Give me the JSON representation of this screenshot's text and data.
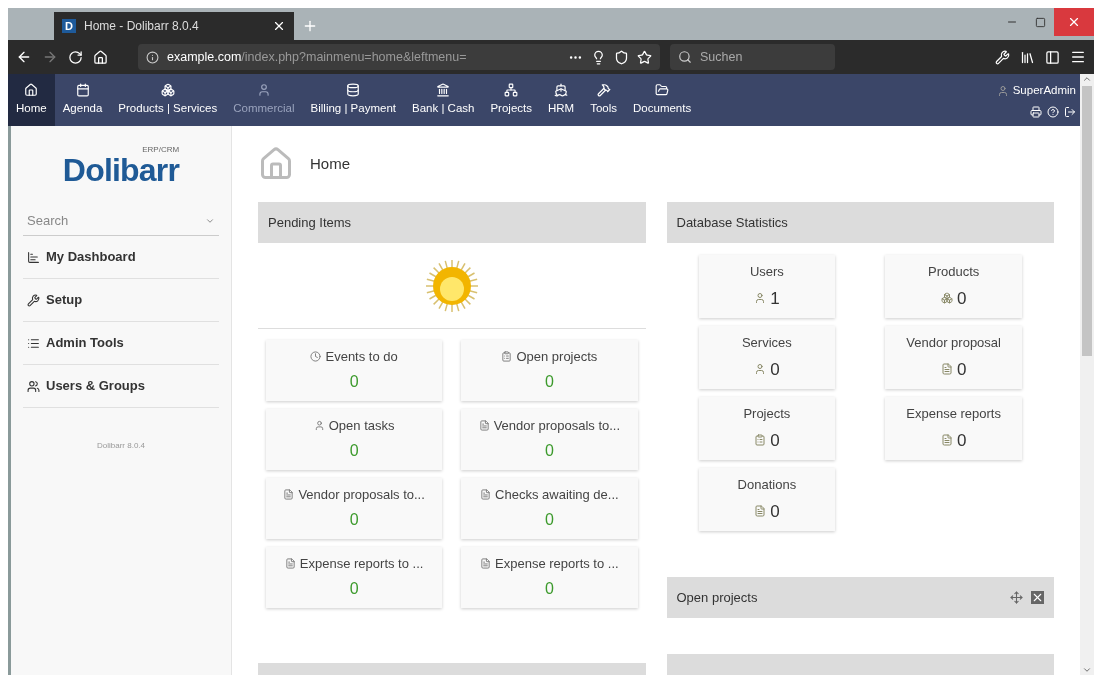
{
  "browser": {
    "tab_title": "Home - Dolibarr 8.0.4",
    "tab_favicon": "D",
    "url_host": "example.com",
    "url_path": "/index.php?mainmenu=home&leftmenu=",
    "search_placeholder": "Suchen"
  },
  "topnav": {
    "items": [
      {
        "label": "Home",
        "selected": true,
        "disabled": false
      },
      {
        "label": "Agenda",
        "selected": false,
        "disabled": false
      },
      {
        "label": "Products | Services",
        "selected": false,
        "disabled": false
      },
      {
        "label": "Commercial",
        "selected": false,
        "disabled": true
      },
      {
        "label": "Billing | Payment",
        "selected": false,
        "disabled": false
      },
      {
        "label": "Bank | Cash",
        "selected": false,
        "disabled": false
      },
      {
        "label": "Projects",
        "selected": false,
        "disabled": false
      },
      {
        "label": "HRM",
        "selected": false,
        "disabled": false
      },
      {
        "label": "Tools",
        "selected": false,
        "disabled": false
      },
      {
        "label": "Documents",
        "selected": false,
        "disabled": false
      }
    ],
    "user": "SuperAdmin"
  },
  "sidebar": {
    "logo": "Dolibarr",
    "logo_tag": "ERP/CRM",
    "search_placeholder": "Search",
    "items": [
      "My Dashboard",
      "Setup",
      "Admin Tools",
      "Users & Groups"
    ],
    "version": "Dolibarr 8.0.4"
  },
  "page_title": "Home",
  "pending": {
    "title": "Pending Items",
    "tiles": [
      {
        "label": "Events to do",
        "value": "0"
      },
      {
        "label": "Open projects",
        "value": "0"
      },
      {
        "label": "Open tasks",
        "value": "0"
      },
      {
        "label": "Vendor proposals to...",
        "value": "0"
      },
      {
        "label": "Vendor proposals to...",
        "value": "0"
      },
      {
        "label": "Checks awaiting de...",
        "value": "0"
      },
      {
        "label": "Expense reports to ...",
        "value": "0"
      },
      {
        "label": "Expense reports to ...",
        "value": "0"
      }
    ]
  },
  "stats": {
    "title": "Database Statistics",
    "tiles": [
      {
        "label": "Users",
        "value": "1"
      },
      {
        "label": "Products",
        "value": "0"
      },
      {
        "label": "Services",
        "value": "0"
      },
      {
        "label": "Vendor proposal",
        "value": "0"
      },
      {
        "label": "Projects",
        "value": "0"
      },
      {
        "label": "Expense reports",
        "value": "0"
      },
      {
        "label": "Donations",
        "value": "0"
      }
    ]
  },
  "open_projects": {
    "title": "Open projects"
  }
}
